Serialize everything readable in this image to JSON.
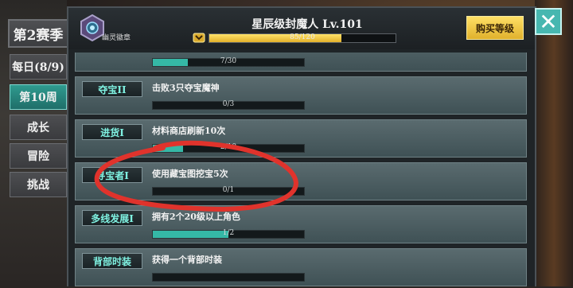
{
  "sidebar": {
    "season": "第2赛季",
    "tabs": [
      {
        "label": "每日(8/9)",
        "active": false
      },
      {
        "label": "第10周",
        "active": true
      },
      {
        "label": "成长",
        "active": false
      },
      {
        "label": "冒险",
        "active": false
      },
      {
        "label": "挑战",
        "active": false
      }
    ]
  },
  "header": {
    "badge_label": "幽灵徽章",
    "title": "星辰级封魔人  Lv.101",
    "xp_text": "85/120",
    "xp_fraction": 0.708,
    "buy_label": "购买等级"
  },
  "rows": [
    {
      "label": "",
      "desc": "",
      "progress_text": "7/30",
      "fraction": 0.233
    },
    {
      "label": "夺宝II",
      "desc": "击败3只夺宝魔神",
      "progress_text": "0/3",
      "fraction": 0
    },
    {
      "label": "进货I",
      "desc": "材料商店刷新10次",
      "progress_text": "2/10",
      "fraction": 0.2
    },
    {
      "label": "寻宝者I",
      "desc": "使用藏宝图挖宝5次",
      "progress_text": "0/1",
      "fraction": 0
    },
    {
      "label": "多线发展I",
      "desc": "拥有2个20级以上角色",
      "progress_text": "1/2",
      "fraction": 0.5
    },
    {
      "label": "背部时装",
      "desc": "获得一个背部时装",
      "progress_text": "",
      "fraction": 0
    }
  ],
  "colors": {
    "accent": "#35b8a6",
    "buy": "#f2c94c",
    "annotation": "#e0332c"
  },
  "icons": {
    "close": "close-icon",
    "badge": "badge-icon",
    "level": "level-icon"
  }
}
